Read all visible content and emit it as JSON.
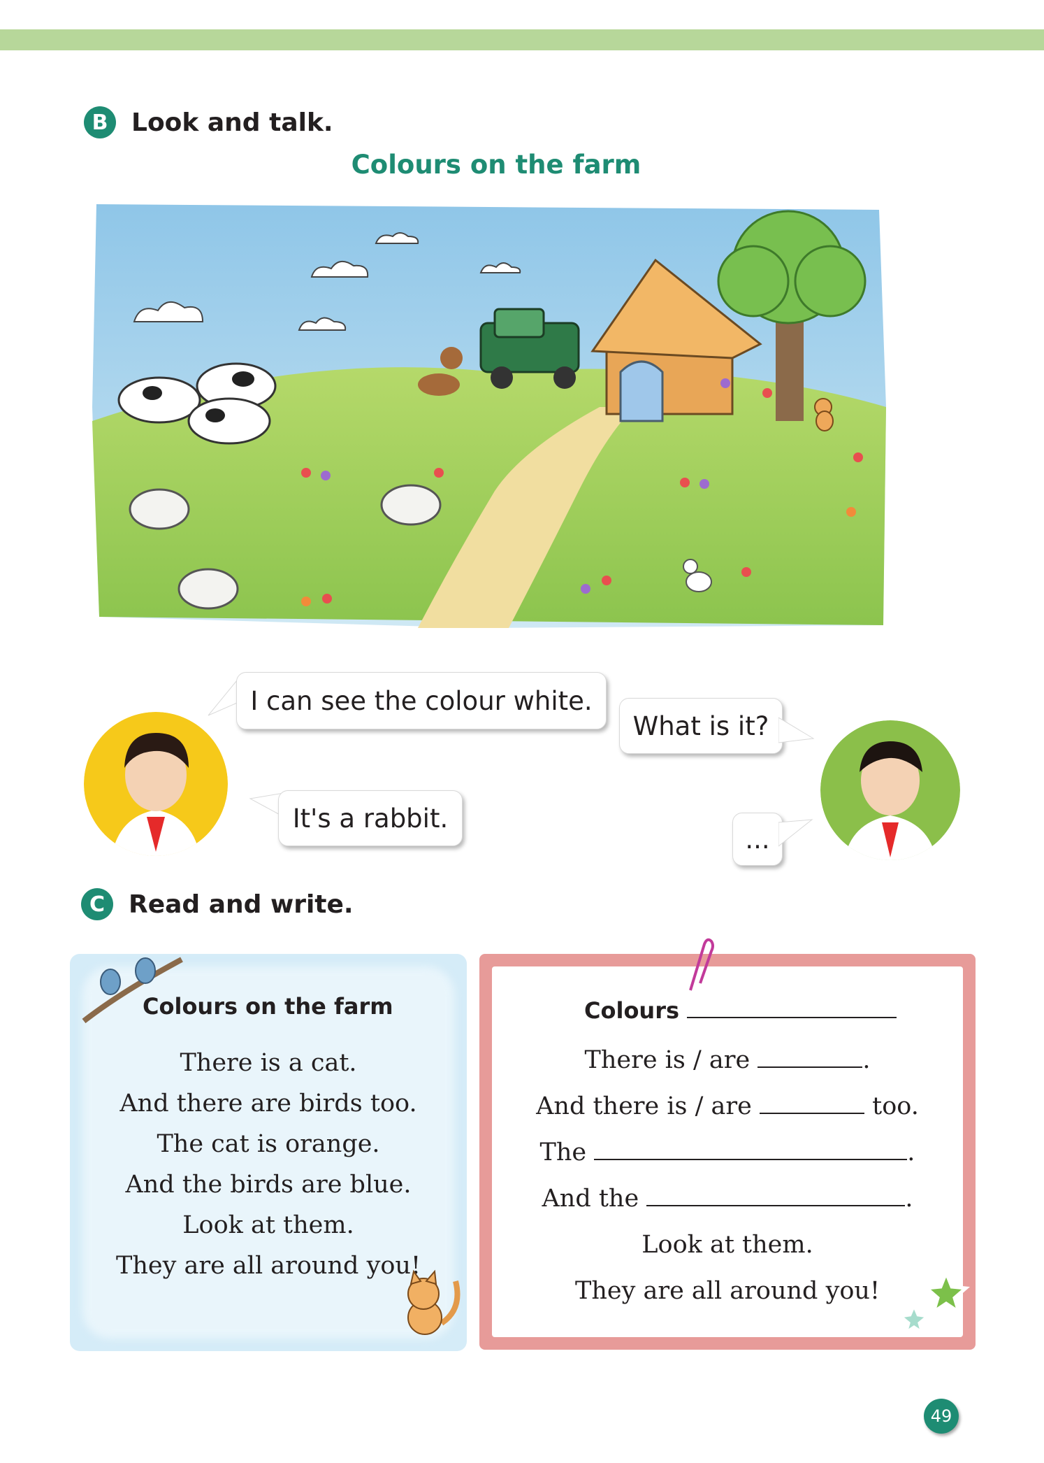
{
  "section_b": {
    "badge": "B",
    "title": "Look and talk."
  },
  "scene": {
    "title": "Colours on the farm"
  },
  "dialogue": {
    "girl_line_1": "I can see the colour white.",
    "girl_line_2": "It's a rabbit.",
    "boy_line_1": "What is it?",
    "boy_line_2": "..."
  },
  "section_c": {
    "badge": "C",
    "title": "Read and write."
  },
  "poem": {
    "title": "Colours on the farm",
    "lines": [
      "There is a cat.",
      "And there are birds too.",
      "The cat is orange.",
      "And the birds are blue.",
      "Look at them.",
      "They are all around you!"
    ]
  },
  "writing": {
    "title": "Colours",
    "line1_prefix": "There is / are",
    "line1_suffix": ".",
    "line2_prefix": "And there is / are",
    "line2_suffix": "too.",
    "line3_prefix": "The",
    "line3_suffix": ".",
    "line4_prefix": "And the",
    "line4_suffix": ".",
    "line5": "Look at them.",
    "line6": "They are all around you!"
  },
  "page_number": "49",
  "colors": {
    "accent_green": "#1e8c73",
    "band_green": "#b7d79a",
    "card_blue": "#d5ecf8",
    "card_pink": "#e79b99"
  }
}
